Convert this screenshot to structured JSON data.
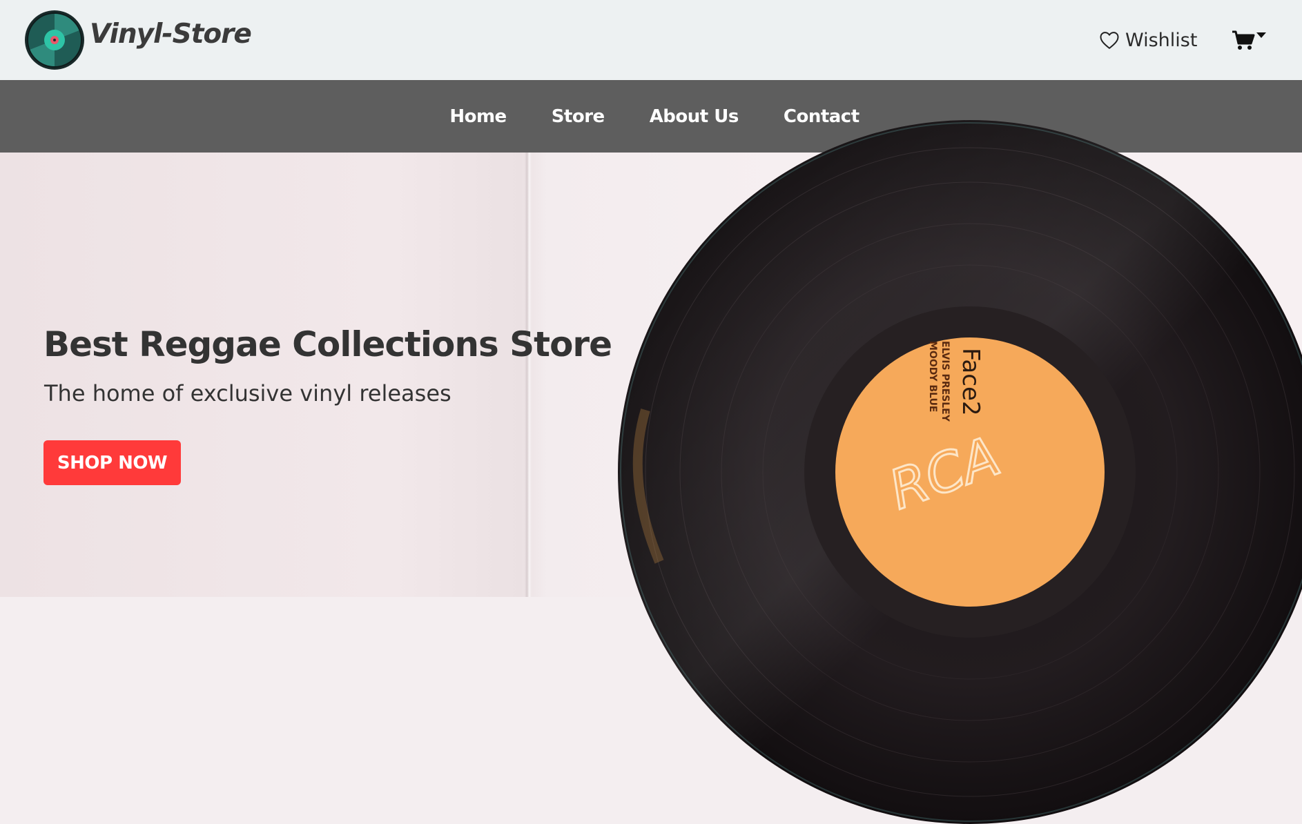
{
  "header": {
    "brand": "Vinyl-Store",
    "wishlist_label": "Wishlist",
    "icons": {
      "logo": "vinyl-record-icon",
      "wishlist": "heart-icon",
      "cart": "cart-icon",
      "cart_menu": "caret-down-icon"
    }
  },
  "nav": {
    "items": [
      {
        "label": "Home"
      },
      {
        "label": "Store"
      },
      {
        "label": "About Us"
      },
      {
        "label": "Contact"
      }
    ]
  },
  "hero": {
    "title": "Best Reggae Collections Store",
    "subtitle": "The home of exclusive vinyl releases",
    "cta_label": "SHOP NOW",
    "record_label": {
      "brand": "RCA",
      "side": "Face2",
      "artist": "ELVIS PRESLEY",
      "album": "MOODY BLUE"
    }
  },
  "colors": {
    "header_bg": "#edf1f2",
    "nav_bg": "#5e5e5e",
    "cta_bg": "#ff3a3a",
    "text_dark": "#333333",
    "logo_teal": "#1f7a6a",
    "record_label": "#f6a95a"
  }
}
